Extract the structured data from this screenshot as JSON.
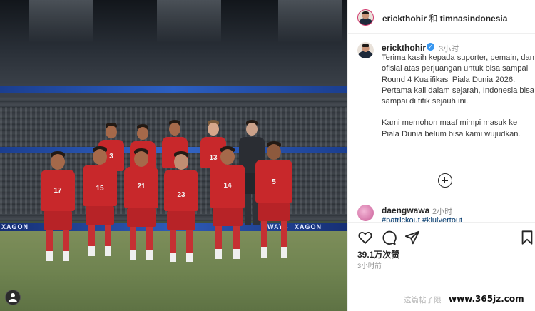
{
  "photo": {
    "ad_boards": [
      "XAGON",
      "WAYS",
      "XAGON"
    ],
    "players_back": [
      {
        "number": "3"
      },
      {
        "number": ""
      },
      {
        "number": ""
      },
      {
        "number": "13"
      },
      {
        "number": ""
      }
    ],
    "players_front": [
      {
        "number": "17"
      },
      {
        "number": "15"
      },
      {
        "number": "21"
      },
      {
        "number": "23"
      },
      {
        "number": "14"
      },
      {
        "number": "5"
      }
    ]
  },
  "header": {
    "account": "erickthohir",
    "conjunction": "和",
    "collaborator": "timnasindonesia"
  },
  "caption": {
    "username": "erickthohir",
    "verified_mark": "✓",
    "time": "3小时",
    "paragraph1": "Terima kasih kepada suporter, pemain, dan ofisial atas perjuangan untuk bisa sampai Round 4 Kualifikasi Piala Dunia 2026. Pertama kali dalam sejarah, Indonesia bisa sampai di titik sejauh ini.",
    "paragraph2": "Kami memohon maaf mimpi masuk ke Piala Dunia belum bisa kami wujudkan."
  },
  "comment": {
    "username": "daengwawa",
    "time": "2小时",
    "text": "#patrickout #kluivertout"
  },
  "actions": {
    "icons": [
      "heart-icon",
      "comment-icon",
      "share-icon",
      "bookmark-icon"
    ]
  },
  "stats": {
    "likes": "39.1万次赞",
    "post_time": "3小时前"
  },
  "footer": {
    "note": "这篇帖子限",
    "watermark": "www.365jz.com"
  }
}
